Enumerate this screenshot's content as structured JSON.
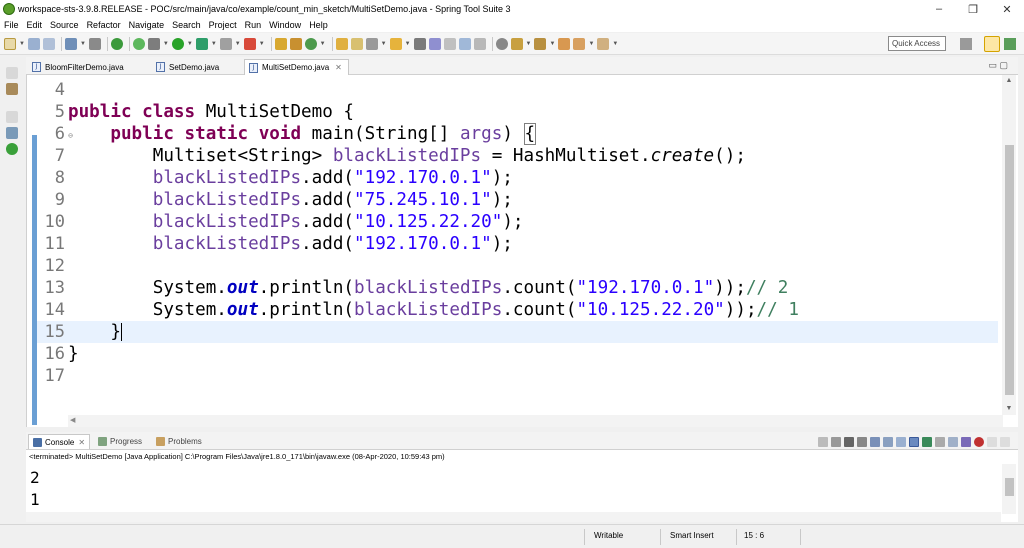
{
  "window": {
    "title": "workspace-sts-3.9.8.RELEASE - POC/src/main/java/co/example/count_min_sketch/MultiSetDemo.java - Spring Tool Suite 3",
    "minimize": "–",
    "maximize": "❐",
    "close": "✕"
  },
  "menu": [
    "File",
    "Edit",
    "Source",
    "Refactor",
    "Navigate",
    "Search",
    "Project",
    "Run",
    "Window",
    "Help"
  ],
  "toolbar": {
    "quick_access": "Quick Access"
  },
  "editor_tabs": [
    {
      "label": "BloomFilterDemo.java",
      "active": false
    },
    {
      "label": "SetDemo.java",
      "active": false
    },
    {
      "label": "MultiSetDemo.java",
      "active": true
    }
  ],
  "editor": {
    "lines": [
      {
        "num": "4",
        "code": ""
      },
      {
        "num": "5",
        "code": "public class MultiSetDemo {"
      },
      {
        "num": "6",
        "code": "    public static void main(String[] args) {"
      },
      {
        "num": "7",
        "code": "        Multiset<String> blackListedIPs = HashMultiset.create();"
      },
      {
        "num": "8",
        "code": "        blackListedIPs.add(\"192.170.0.1\");"
      },
      {
        "num": "9",
        "code": "        blackListedIPs.add(\"75.245.10.1\");"
      },
      {
        "num": "10",
        "code": "        blackListedIPs.add(\"10.125.22.20\");"
      },
      {
        "num": "11",
        "code": "        blackListedIPs.add(\"192.170.0.1\");"
      },
      {
        "num": "12",
        "code": ""
      },
      {
        "num": "13",
        "code": "        System.out.println(blackListedIPs.count(\"192.170.0.1\"));// 2"
      },
      {
        "num": "14",
        "code": "        System.out.println(blackListedIPs.count(\"10.125.22.20\"));// 1"
      },
      {
        "num": "15",
        "code": "    }"
      },
      {
        "num": "16",
        "code": "}"
      },
      {
        "num": "17",
        "code": ""
      }
    ]
  },
  "console": {
    "tabs": [
      {
        "label": "Console",
        "active": true
      },
      {
        "label": "Progress",
        "active": false
      },
      {
        "label": "Problems",
        "active": false
      }
    ],
    "terminated": "<terminated> MultiSetDemo [Java Application] C:\\Program Files\\Java\\jre1.8.0_171\\bin\\javaw.exe (08-Apr-2020, 10:59:43 pm)",
    "output": [
      "2",
      "1"
    ]
  },
  "status": {
    "writable": "Writable",
    "insert_mode": "Smart Insert",
    "position": "15 : 6"
  }
}
